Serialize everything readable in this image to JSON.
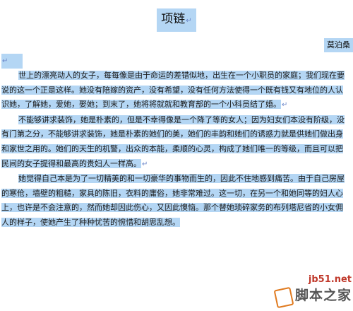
{
  "document": {
    "title": "项链",
    "author": "莫泊桑",
    "paragraph_mark": "↵",
    "paragraphs": [
      "世上的漂亮动人的女子，每每像是由于命运的差错似地，出生在一个小职员的家庭；我们现在要说的这一个正是这样。她没有陪嫁的资产，没有希望，没有任何方法使得一个既有钱又有地位的人认识她，了解她，爱她，娶她；到末了，她将将就就和教育部的一个小科员结了婚。",
      "不能够讲求装饰，她是朴素的，但是不幸得像是一个降了等的女人；因为妇女们本没有阶级，没有门第之分，不能够讲求装饰，她是朴素的她们的美，她们的丰韵和她们的诱惑力就是供她们做出身和家世之用的。她们的天生的机警，出众的本能，柔顺的心灵，构成了她们唯一的等级，而且可以把民间的女子提得和最高的贵妇人一样高。",
      "她觉得自己本是为了一切精美的和一切豪华的事物而生的，因此不住地感到痛苦。由于自己房屋的寒伧，墙壁的粗糙，家具的陈旧，衣料的庸俗，她非常难过。这一切，在另一个和她同等的妇人心上，也许是不会注意的，然而她却因此伤心，又因此懊恼。那个替她琐碎家务的布列塔尼省的小女佣人的样子，使她产生了种种忧苦的惋惜和胡思乱想。"
    ]
  },
  "watermark": {
    "url": "jb51.net",
    "name": "脚本之家"
  }
}
